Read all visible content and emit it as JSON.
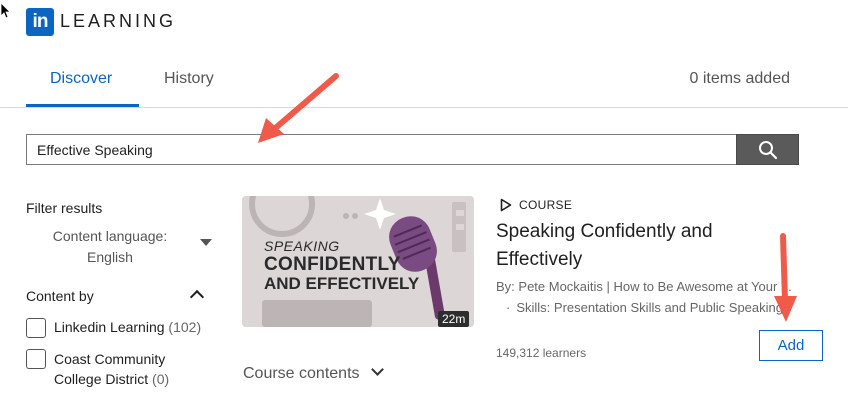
{
  "brand": {
    "logo_mark": "in",
    "product": "LEARNING",
    "color": "#0a66c2"
  },
  "tabs": [
    {
      "label": "Discover",
      "active": true
    },
    {
      "label": "History",
      "active": false
    }
  ],
  "items_added": "0 items added",
  "search": {
    "value": "Effective Speaking",
    "icon": "search-icon"
  },
  "filters": {
    "title": "Filter results",
    "content_language_label": "Content language:",
    "content_language_value": "English",
    "content_by_title": "Content by",
    "options": [
      {
        "name": "Linkedin Learning",
        "count": "(102)",
        "checked": false
      },
      {
        "name": "Coast Community College District",
        "count": "(0)",
        "checked": false
      }
    ]
  },
  "course": {
    "type": "COURSE",
    "title": "Speaking Confidently and Effectively",
    "author": "By: Pete Mockaitis | How to Be Awesome at Your ...",
    "skills": "Skills: Presentation Skills and Public Speaking",
    "learners": "149,312 learners",
    "duration": "22m",
    "add_label": "Add",
    "thumbnail": {
      "line1": "SPEAKING",
      "line2": "CONFIDENTLY",
      "line3": "AND EFFECTIVELY"
    },
    "contents_label": "Course contents"
  },
  "annotation_color": "#ef5a4a"
}
